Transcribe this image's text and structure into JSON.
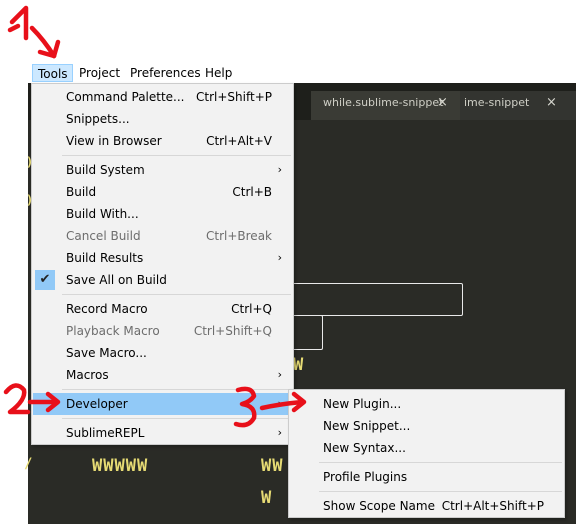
{
  "menubar": {
    "items": [
      {
        "label": "Tools",
        "active": true
      },
      {
        "label": "Project"
      },
      {
        "label": "Preferences"
      },
      {
        "label": "Help"
      }
    ]
  },
  "editor": {
    "tabs": [
      {
        "label": "while.sublime-snippet",
        "close": "×"
      },
      {
        "label": "ime-snippet",
        "close": "×"
      }
    ],
    "code_lines": [
      "W",
      "WWWWW",
      "WW",
      "W"
    ]
  },
  "tools_menu": {
    "items": [
      {
        "label": "Command Palette...",
        "shortcut": "Ctrl+Shift+P"
      },
      {
        "label": "Snippets..."
      },
      {
        "label": "View in Browser",
        "shortcut": "Ctrl+Alt+V"
      },
      {
        "label": "Build System",
        "arrow": "›"
      },
      {
        "label": "Build",
        "shortcut": "Ctrl+B"
      },
      {
        "label": "Build With..."
      },
      {
        "label": "Cancel Build",
        "shortcut": "Ctrl+Break"
      },
      {
        "label": "Build Results",
        "arrow": "›"
      },
      {
        "label": "Save All on Build",
        "check": "✔"
      },
      {
        "label": "Record Macro",
        "shortcut": "Ctrl+Q"
      },
      {
        "label": "Playback Macro",
        "shortcut": "Ctrl+Shift+Q"
      },
      {
        "label": "Save Macro..."
      },
      {
        "label": "Macros",
        "arrow": "›"
      },
      {
        "label": "Developer",
        "arrow": "›"
      },
      {
        "label": "SublimeREPL",
        "arrow": "›"
      }
    ]
  },
  "developer_menu": {
    "items": [
      {
        "label": "New Plugin..."
      },
      {
        "label": "New Snippet..."
      },
      {
        "label": "New Syntax..."
      },
      {
        "label": "Profile Plugins"
      },
      {
        "label": "Show Scope Name",
        "shortcut": "Ctrl+Alt+Shift+P"
      }
    ]
  },
  "annotations": {
    "color": "#e8101a",
    "steps": [
      "1",
      "2",
      "3"
    ]
  }
}
